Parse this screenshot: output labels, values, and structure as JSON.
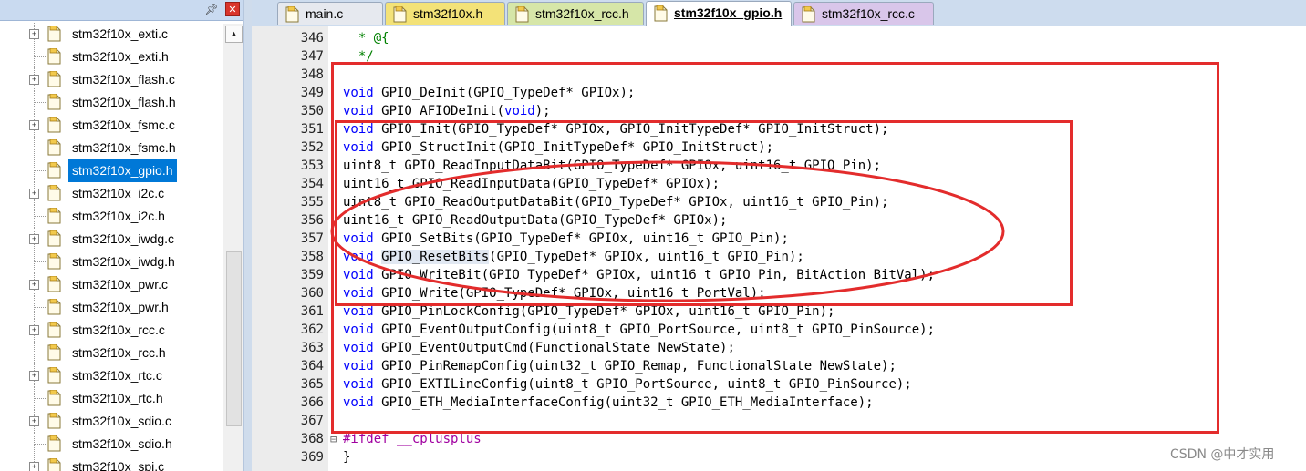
{
  "sidebar": {
    "pin_icon": "pin-icon",
    "close_icon": "close-icon",
    "files": [
      {
        "name": "stm32f10x_exti.c",
        "expandable": true,
        "selected": false
      },
      {
        "name": "stm32f10x_exti.h",
        "expandable": false,
        "selected": false
      },
      {
        "name": "stm32f10x_flash.c",
        "expandable": true,
        "selected": false
      },
      {
        "name": "stm32f10x_flash.h",
        "expandable": false,
        "selected": false
      },
      {
        "name": "stm32f10x_fsmc.c",
        "expandable": true,
        "selected": false
      },
      {
        "name": "stm32f10x_fsmc.h",
        "expandable": false,
        "selected": false
      },
      {
        "name": "stm32f10x_gpio.h",
        "expandable": false,
        "selected": true
      },
      {
        "name": "stm32f10x_i2c.c",
        "expandable": true,
        "selected": false
      },
      {
        "name": "stm32f10x_i2c.h",
        "expandable": false,
        "selected": false
      },
      {
        "name": "stm32f10x_iwdg.c",
        "expandable": true,
        "selected": false
      },
      {
        "name": "stm32f10x_iwdg.h",
        "expandable": false,
        "selected": false
      },
      {
        "name": "stm32f10x_pwr.c",
        "expandable": true,
        "selected": false
      },
      {
        "name": "stm32f10x_pwr.h",
        "expandable": false,
        "selected": false
      },
      {
        "name": "stm32f10x_rcc.c",
        "expandable": true,
        "selected": false
      },
      {
        "name": "stm32f10x_rcc.h",
        "expandable": false,
        "selected": false
      },
      {
        "name": "stm32f10x_rtc.c",
        "expandable": true,
        "selected": false
      },
      {
        "name": "stm32f10x_rtc.h",
        "expandable": false,
        "selected": false
      },
      {
        "name": "stm32f10x_sdio.c",
        "expandable": true,
        "selected": false
      },
      {
        "name": "stm32f10x_sdio.h",
        "expandable": false,
        "selected": false
      },
      {
        "name": "stm32f10x_spi.c",
        "expandable": true,
        "selected": false
      }
    ]
  },
  "tabs": [
    {
      "label": "main.c",
      "color": "#e6e9ef",
      "active": false
    },
    {
      "label": "stm32f10x.h",
      "color": "#f3e278",
      "active": false
    },
    {
      "label": "stm32f10x_rcc.h",
      "color": "#d6e6a8",
      "active": false
    },
    {
      "label": "stm32f10x_gpio.h",
      "color": "#f6c8cf",
      "active": true
    },
    {
      "label": "stm32f10x_rcc.c",
      "color": "#d9c6ea",
      "active": false
    }
  ],
  "editor": {
    "lines": [
      {
        "n": "346",
        "fold": "",
        "cls": "cm",
        "text": "  * @{"
      },
      {
        "n": "347",
        "fold": "",
        "cls": "cm",
        "text": "  */"
      },
      {
        "n": "348",
        "fold": "",
        "cls": "",
        "text": ""
      },
      {
        "n": "349",
        "fold": "",
        "cls": "",
        "text": "void GPIO_DeInit(GPIO_TypeDef* GPIOx);"
      },
      {
        "n": "350",
        "fold": "",
        "cls": "",
        "text": "void GPIO_AFIODeInit(void);"
      },
      {
        "n": "351",
        "fold": "",
        "cls": "",
        "text": "void GPIO_Init(GPIO_TypeDef* GPIOx, GPIO_InitTypeDef* GPIO_InitStruct);"
      },
      {
        "n": "352",
        "fold": "",
        "cls": "",
        "text": "void GPIO_StructInit(GPIO_InitTypeDef* GPIO_InitStruct);"
      },
      {
        "n": "353",
        "fold": "",
        "cls": "",
        "text": "uint8_t GPIO_ReadInputDataBit(GPIO_TypeDef* GPIOx, uint16_t GPIO_Pin);"
      },
      {
        "n": "354",
        "fold": "",
        "cls": "",
        "text": "uint16_t GPIO_ReadInputData(GPIO_TypeDef* GPIOx);"
      },
      {
        "n": "355",
        "fold": "",
        "cls": "",
        "text": "uint8_t GPIO_ReadOutputDataBit(GPIO_TypeDef* GPIOx, uint16_t GPIO_Pin);"
      },
      {
        "n": "356",
        "fold": "",
        "cls": "",
        "text": "uint16_t GPIO_ReadOutputData(GPIO_TypeDef* GPIOx);"
      },
      {
        "n": "357",
        "fold": "",
        "cls": "",
        "text": "void GPIO_SetBits(GPIO_TypeDef* GPIOx, uint16_t GPIO_Pin);"
      },
      {
        "n": "358",
        "fold": "",
        "cls": "",
        "text": "void GPIO_ResetBits(GPIO_TypeDef* GPIOx, uint16_t GPIO_Pin);"
      },
      {
        "n": "359",
        "fold": "",
        "cls": "",
        "text": "void GPIO_WriteBit(GPIO_TypeDef* GPIOx, uint16_t GPIO_Pin, BitAction BitVal);"
      },
      {
        "n": "360",
        "fold": "",
        "cls": "",
        "text": "void GPIO_Write(GPIO_TypeDef* GPIOx, uint16_t PortVal);"
      },
      {
        "n": "361",
        "fold": "",
        "cls": "",
        "text": "void GPIO_PinLockConfig(GPIO_TypeDef* GPIOx, uint16_t GPIO_Pin);"
      },
      {
        "n": "362",
        "fold": "",
        "cls": "",
        "text": "void GPIO_EventOutputConfig(uint8_t GPIO_PortSource, uint8_t GPIO_PinSource);"
      },
      {
        "n": "363",
        "fold": "",
        "cls": "",
        "text": "void GPIO_EventOutputCmd(FunctionalState NewState);"
      },
      {
        "n": "364",
        "fold": "",
        "cls": "",
        "text": "void GPIO_PinRemapConfig(uint32_t GPIO_Remap, FunctionalState NewState);"
      },
      {
        "n": "365",
        "fold": "",
        "cls": "",
        "text": "void GPIO_EXTILineConfig(uint8_t GPIO_PortSource, uint8_t GPIO_PinSource);"
      },
      {
        "n": "366",
        "fold": "",
        "cls": "",
        "text": "void GPIO_ETH_MediaInterfaceConfig(uint32_t GPIO_ETH_MediaInterface);"
      },
      {
        "n": "367",
        "fold": "",
        "cls": "",
        "text": ""
      },
      {
        "n": "368",
        "fold": "⊟",
        "cls": "pp",
        "text": "#ifdef __cplusplus"
      },
      {
        "n": "369",
        "fold": "",
        "cls": "",
        "text": "}"
      }
    ],
    "highlight_word": "GPIO_ResetBits",
    "highlight_line": "358"
  },
  "annotation_color": "#e32c2c",
  "watermark": "CSDN @中才实用"
}
